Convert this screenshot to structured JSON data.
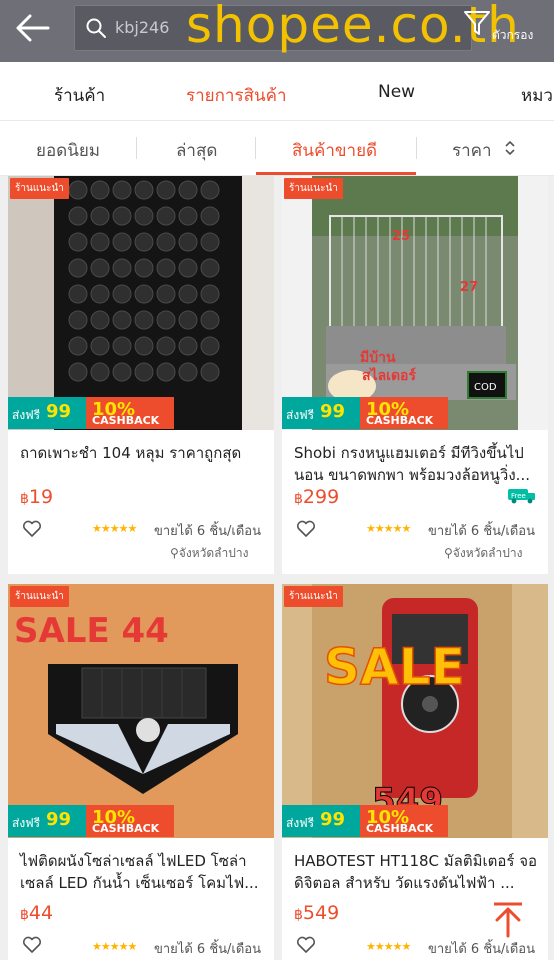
{
  "header": {
    "search_value": "kbj246",
    "watermark": "shopee.co.th",
    "filter_label": "ตัวกรอง"
  },
  "tabs": [
    {
      "label": "ร้านค้า",
      "active": false
    },
    {
      "label": "รายการสินค้า",
      "active": true
    },
    {
      "label": "New",
      "active": false
    },
    {
      "label": "หมว",
      "active": false
    }
  ],
  "sort": [
    {
      "label": "ยอดนิยม",
      "active": false
    },
    {
      "label": "ล่าสุด",
      "active": false
    },
    {
      "label": "สินค้าขายดี",
      "active": true
    },
    {
      "label": "ราคา",
      "active": false
    }
  ],
  "promo": {
    "free_text": "ส่งฟรี",
    "free_num": "99",
    "cashback_percent": "10%",
    "cashback_word": "CASHBACK"
  },
  "products": [
    {
      "badge": "ร้านแนะนำ",
      "title": "ถาดเพาะชำ 104 หลุม ราคาถูกสุด",
      "currency": "฿",
      "price": "19",
      "stars": "★★★★★",
      "sold": "ขายได้ 6 ชิ้น/เดือน",
      "location": "จังหวัดลำปาง",
      "free_shipping": false
    },
    {
      "badge": "ร้านแนะนำ",
      "title": "Shobi กรงหนูแฮมเตอร์ มีทีวิงขึ้นไป นอน ขนาดพกพา พร้อมวงล้อหนูวิ่ง...",
      "currency": "฿",
      "price": "299",
      "stars": "★★★★★",
      "sold": "ขายได้ 6 ชิ้น/เดือน",
      "location": "จังหวัดลำปาง",
      "free_shipping": true,
      "img_text_1": "25",
      "img_text_2": "27",
      "img_text_3": "มีบ้าน",
      "img_text_4": "สไลเดอร์",
      "img_text_5": "COD"
    },
    {
      "badge": "ร้านแนะนำ",
      "title": "ไฟติดผนังโซล่าเซลล์ ไฟLED โซล่าเซลล์ LED กันน้ำ เซ็นเซอร์ โคมไฟ...",
      "currency": "฿",
      "price": "44",
      "stars": "★★★★★",
      "sold": "ขายได้ 6 ชิ้น/เดือน",
      "img_text": "SALE 44"
    },
    {
      "badge": "ร้านแนะนำ",
      "title": "HABOTEST HT118C มัลติมิเตอร์ จอดิจิตอล สำหรับ วัดแรงดันไฟฟ้า ...",
      "currency": "฿",
      "price": "549",
      "stars": "★★★★★",
      "sold": "ขายได้ 6 ชิ้น/เดือน",
      "img_text_1": "SALE",
      "img_text_2": "549"
    }
  ],
  "colors": {
    "accent": "#ee4d2d",
    "header_bg": "#6f6f78",
    "promo_green": "#00a79d"
  }
}
